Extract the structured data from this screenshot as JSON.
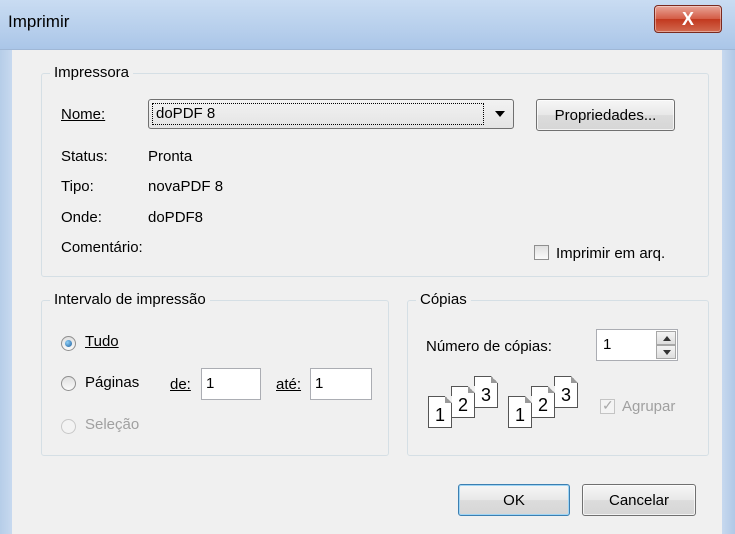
{
  "window": {
    "title": "Imprimir",
    "close_glyph": "X"
  },
  "printer": {
    "group_title": "Impressora",
    "name_label": "Nome:",
    "name_value": "doPDF 8",
    "properties_button": "Propriedades...",
    "status_label": "Status:",
    "status_value": "Pronta",
    "type_label": "Tipo:",
    "type_value": "novaPDF 8",
    "where_label": "Onde:",
    "where_value": "doPDF8",
    "comment_label": "Comentário:",
    "print_to_file_label": "Imprimir em arq.",
    "print_to_file_checked": false
  },
  "range": {
    "group_title": "Intervalo de impressão",
    "all_label": "Tudo",
    "pages_label": "Páginas",
    "from_label": "de:",
    "from_value": "1",
    "to_label": "até:",
    "to_value": "1",
    "selection_label": "Seleção",
    "selected": "all"
  },
  "copies": {
    "group_title": "Cópias",
    "count_label": "Número de cópias:",
    "count_value": "1",
    "collate_label": "Agrupar",
    "collate_checked": true,
    "collate_enabled": false,
    "page_digits": [
      "1",
      "2",
      "3"
    ]
  },
  "buttons": {
    "ok": "OK",
    "cancel": "Cancelar"
  }
}
